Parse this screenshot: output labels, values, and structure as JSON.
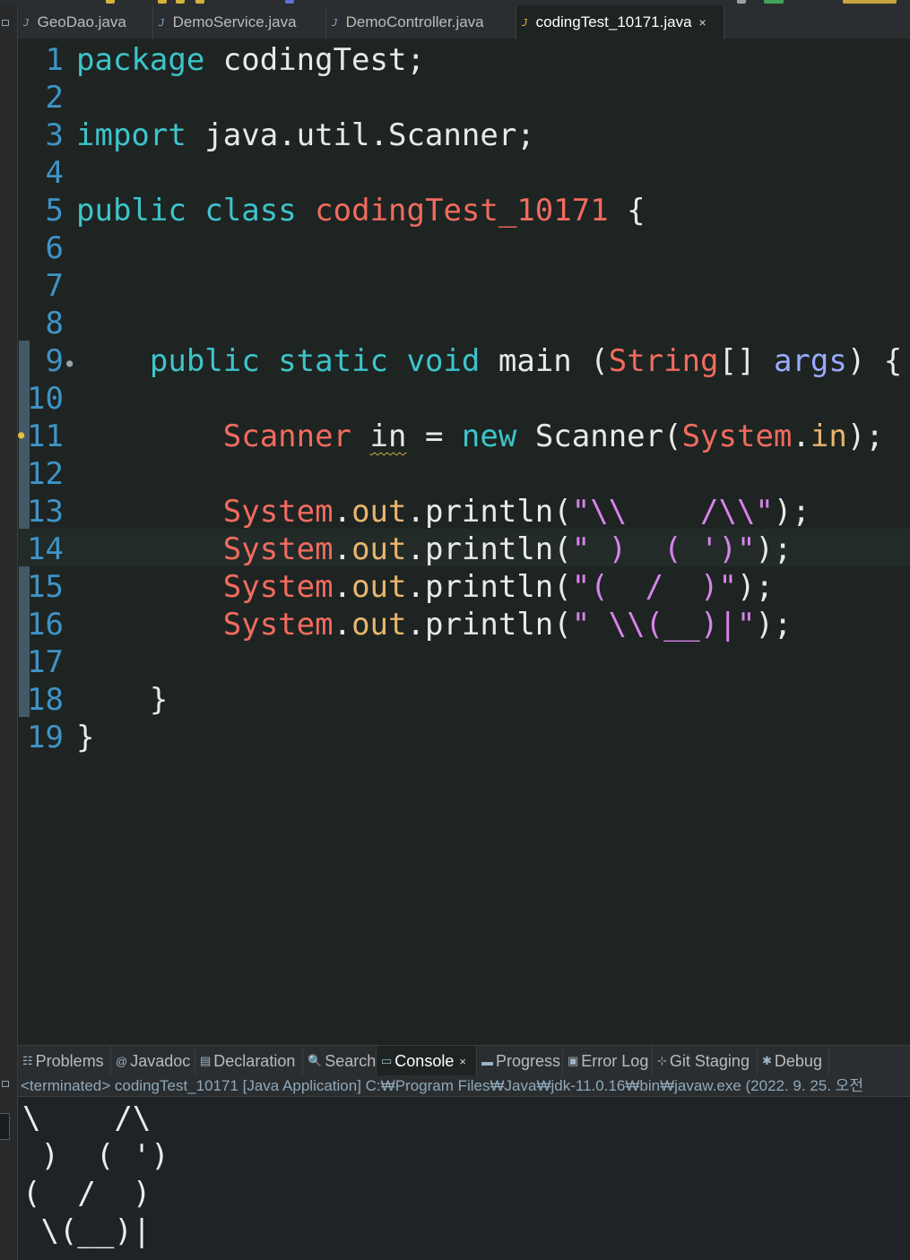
{
  "editor_tabs": [
    {
      "label": "GeoDao.java",
      "icon": "java-file-icon",
      "active": false
    },
    {
      "label": "DemoService.java",
      "icon": "java-file-icon",
      "active": false
    },
    {
      "label": "DemoController.java",
      "icon": "java-file-icon",
      "active": false
    },
    {
      "label": "codingTest_10171.java",
      "icon": "java-file-icon",
      "active": true
    }
  ],
  "tab_close_glyph": "×",
  "editor": {
    "current_line": 14,
    "line_numbers": [
      "1",
      "2",
      "3",
      "4",
      "5",
      "6",
      "7",
      "8",
      "9",
      "10",
      "11",
      "12",
      "13",
      "14",
      "15",
      "16",
      "17",
      "18",
      "19"
    ],
    "lines": [
      [
        {
          "t": "package",
          "c": "kw"
        },
        {
          "t": " codingTest;",
          "c": "pl"
        }
      ],
      [],
      [
        {
          "t": "import",
          "c": "kw"
        },
        {
          "t": " java.util.Scanner;",
          "c": "pl"
        }
      ],
      [],
      [
        {
          "t": "public",
          "c": "kw"
        },
        {
          "t": " ",
          "c": "pl"
        },
        {
          "t": "class",
          "c": "kw"
        },
        {
          "t": " ",
          "c": "pl"
        },
        {
          "t": "codingTest_10171",
          "c": "cls"
        },
        {
          "t": " {",
          "c": "pl"
        }
      ],
      [],
      [],
      [],
      [
        {
          "t": "    ",
          "c": "pl"
        },
        {
          "t": "public",
          "c": "kw"
        },
        {
          "t": " ",
          "c": "pl"
        },
        {
          "t": "static",
          "c": "kw"
        },
        {
          "t": " ",
          "c": "pl"
        },
        {
          "t": "void",
          "c": "kw"
        },
        {
          "t": " main (",
          "c": "pl"
        },
        {
          "t": "String",
          "c": "cls"
        },
        {
          "t": "[] ",
          "c": "pl"
        },
        {
          "t": "args",
          "c": "vr"
        },
        {
          "t": ") {",
          "c": "pl"
        }
      ],
      [],
      [
        {
          "t": "        ",
          "c": "pl"
        },
        {
          "t": "Scanner",
          "c": "cls"
        },
        {
          "t": " ",
          "c": "pl"
        },
        {
          "t": "in",
          "c": "pl warn"
        },
        {
          "t": " = ",
          "c": "pl"
        },
        {
          "t": "new",
          "c": "kw"
        },
        {
          "t": " Scanner(",
          "c": "pl"
        },
        {
          "t": "System",
          "c": "cls"
        },
        {
          "t": ".",
          "c": "pl"
        },
        {
          "t": "in",
          "c": "fld"
        },
        {
          "t": ");",
          "c": "pl"
        }
      ],
      [],
      [
        {
          "t": "        ",
          "c": "pl"
        },
        {
          "t": "System",
          "c": "cls"
        },
        {
          "t": ".",
          "c": "pl"
        },
        {
          "t": "out",
          "c": "fld"
        },
        {
          "t": ".println(",
          "c": "pl"
        },
        {
          "t": "\"\\\\    /\\\\\"",
          "c": "str"
        },
        {
          "t": ");",
          "c": "pl"
        }
      ],
      [
        {
          "t": "        ",
          "c": "pl"
        },
        {
          "t": "System",
          "c": "cls"
        },
        {
          "t": ".",
          "c": "pl"
        },
        {
          "t": "out",
          "c": "fld"
        },
        {
          "t": ".println(",
          "c": "pl"
        },
        {
          "t": "\" )  ( ')\"",
          "c": "str"
        },
        {
          "t": ");",
          "c": "pl"
        }
      ],
      [
        {
          "t": "        ",
          "c": "pl"
        },
        {
          "t": "System",
          "c": "cls"
        },
        {
          "t": ".",
          "c": "pl"
        },
        {
          "t": "out",
          "c": "fld"
        },
        {
          "t": ".println(",
          "c": "pl"
        },
        {
          "t": "\"(  /  )\"",
          "c": "str"
        },
        {
          "t": ");",
          "c": "pl"
        }
      ],
      [
        {
          "t": "        ",
          "c": "pl"
        },
        {
          "t": "System",
          "c": "cls"
        },
        {
          "t": ".",
          "c": "pl"
        },
        {
          "t": "out",
          "c": "fld"
        },
        {
          "t": ".println(",
          "c": "pl"
        },
        {
          "t": "\" \\\\(__)|\"",
          "c": "str"
        },
        {
          "t": ");",
          "c": "pl"
        }
      ],
      [],
      [
        {
          "t": "    }",
          "c": "pl"
        }
      ],
      [
        {
          "t": "}",
          "c": "pl"
        }
      ]
    ]
  },
  "view_tabs": [
    {
      "label": "Problems",
      "icon": "problems-icon",
      "glyph": "☷"
    },
    {
      "label": "Javadoc",
      "icon": "javadoc-icon",
      "glyph": "@"
    },
    {
      "label": "Declaration",
      "icon": "declaration-icon",
      "glyph": "▤"
    },
    {
      "label": "Search",
      "icon": "search-icon",
      "glyph": "🔍"
    },
    {
      "label": "Console",
      "icon": "console-icon",
      "glyph": "▭",
      "active": true
    },
    {
      "label": "Progress",
      "icon": "progress-icon",
      "glyph": "▬"
    },
    {
      "label": "Error Log",
      "icon": "error-log-icon",
      "glyph": "▣"
    },
    {
      "label": "Git Staging",
      "icon": "git-staging-icon",
      "glyph": "⊹"
    },
    {
      "label": "Debug",
      "icon": "debug-icon",
      "glyph": "✱"
    }
  ],
  "console": {
    "status": "<terminated> codingTest_10171 [Java Application] C:₩Program Files₩Java₩jdk-11.0.16₩bin₩javaw.exe  (2022. 9. 25. 오전",
    "output": [
      "\\    /\\",
      " )  ( ')",
      "(  /  )",
      " \\(__)|"
    ]
  },
  "colors": {
    "background": "#1e2421",
    "keyword": "#3dc4cb",
    "class": "#f16b5f",
    "field": "#e9b56d",
    "string": "#d883ec",
    "line_number": "#3f93c6"
  }
}
